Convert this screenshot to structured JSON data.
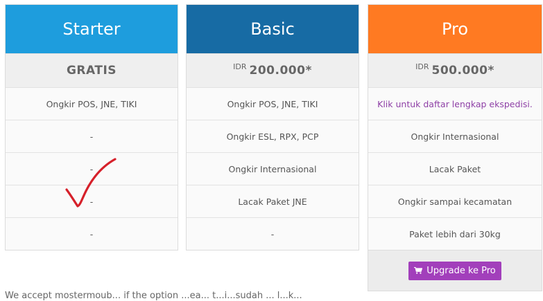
{
  "plans": [
    {
      "name": "Starter",
      "price_currency": "",
      "price": "GRATIS",
      "features": [
        "Ongkir POS, JNE, TIKI",
        "-",
        "-",
        "-",
        "-"
      ]
    },
    {
      "name": "Basic",
      "price_currency": "IDR",
      "price": "200.000*",
      "features": [
        "Ongkir POS, JNE, TIKI",
        "Ongkir ESL, RPX, PCP",
        "Ongkir Internasional",
        "Lacak Paket JNE",
        "-"
      ]
    },
    {
      "name": "Pro",
      "price_currency": "IDR",
      "price": "500.000*",
      "features": [
        "Klik untuk daftar lengkap ekspedisi.",
        "Ongkir Internasional",
        "Lacak Paket",
        "Ongkir sampai kecamatan",
        "Paket lebih dari 30kg"
      ],
      "upgrade_label": "Upgrade ke Pro"
    }
  ],
  "colors": {
    "starter": "#1e9ddd",
    "basic": "#176ba4",
    "pro": "#ff7a22",
    "button": "#a23fbb",
    "link": "#8e3fa6",
    "checkmark": "#d6202a"
  },
  "icons": {
    "upgrade_button": "cart-icon",
    "annotation": "checkmark-icon"
  },
  "bottom_text": "We accept mostermoub... if the option ...ea... t...i...sudah ... l...k..."
}
